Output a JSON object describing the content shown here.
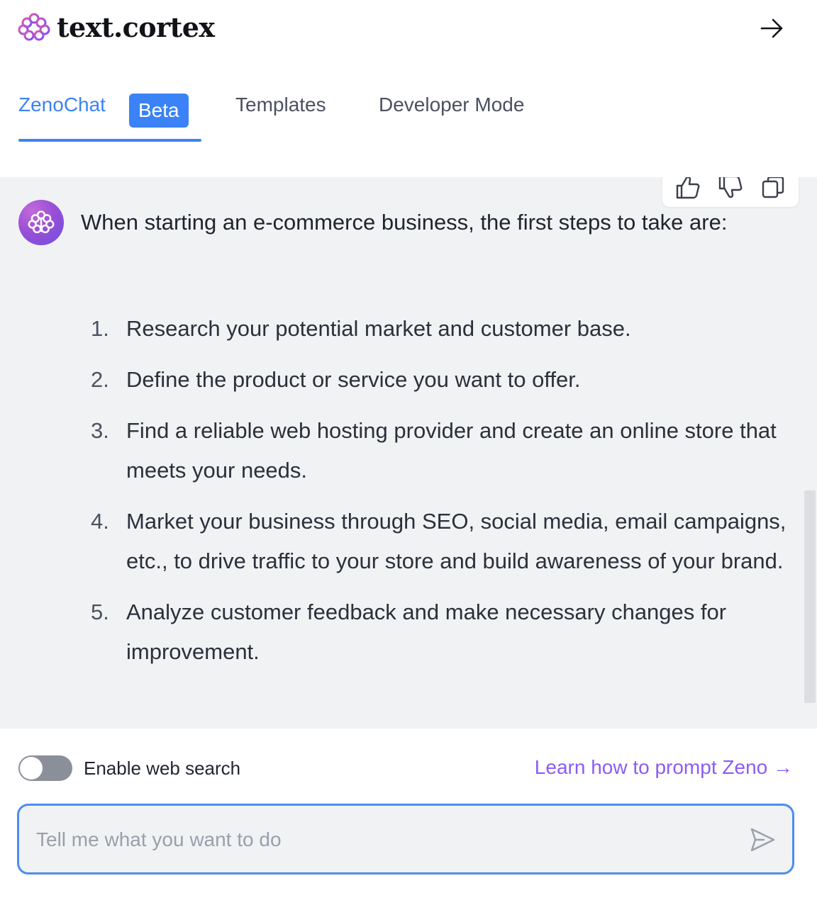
{
  "header": {
    "brand": "text.cortex",
    "logo_icon": "brain-icon",
    "collapse_icon": "arrow-right-icon"
  },
  "tabs": [
    {
      "label": "ZenoChat",
      "active": true,
      "badge": "Beta"
    },
    {
      "label": "Templates",
      "active": false
    },
    {
      "label": "Developer Mode",
      "active": false
    }
  ],
  "chat": {
    "feedback_icons": [
      "thumbs-up-icon",
      "thumbs-down-icon",
      "copy-icon"
    ],
    "message_intro": "When starting an e-commerce business, the first steps to take are:",
    "steps": [
      {
        "num": "1.",
        "text": "Research your potential market and customer base."
      },
      {
        "num": "2.",
        "text": "Define the product or service you want to offer."
      },
      {
        "num": "3.",
        "text": "Find a reliable web hosting provider and create an online store that meets your needs."
      },
      {
        "num": "4.",
        "text": "Market your business through SEO, social media, email campaigns, etc., to drive traffic to your store and build awareness of your brand."
      },
      {
        "num": "5.",
        "text": "Analyze customer feedback and make necessary changes for improvement."
      }
    ]
  },
  "controls": {
    "web_search_label": "Enable web search",
    "web_search_enabled": false,
    "learn_link": "Learn how to prompt Zeno →",
    "input_placeholder": "Tell me what you want to do",
    "input_value": "",
    "send_icon": "send-icon"
  },
  "colors": {
    "accent": "#3b82f6",
    "link": "#8b5cf6",
    "chat_bg": "#f1f2f4",
    "toggle_off": "#8a8f99"
  }
}
